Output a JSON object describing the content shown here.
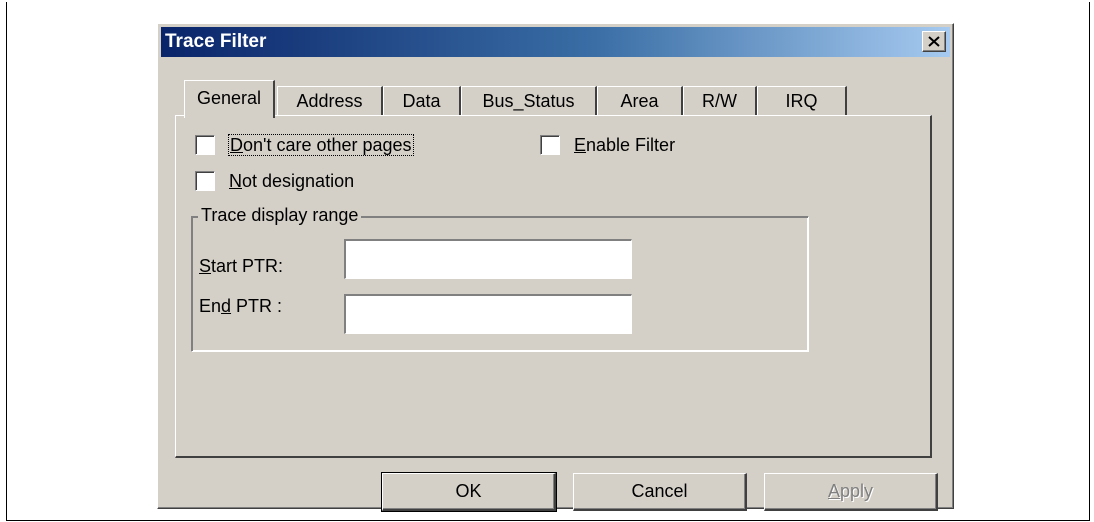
{
  "dialog": {
    "title": "Trace Filter",
    "close_label": "×"
  },
  "tabs": [
    {
      "label": "General",
      "active": true
    },
    {
      "label": "Address",
      "active": false
    },
    {
      "label": "Data",
      "active": false
    },
    {
      "label": "Bus_Status",
      "active": false
    },
    {
      "label": "Area",
      "active": false
    },
    {
      "label": "R/W",
      "active": false
    },
    {
      "label": "IRQ",
      "active": false
    }
  ],
  "general": {
    "dont_care": {
      "mnemonic": "D",
      "rest": "on't care other pages",
      "checked": false
    },
    "enable_filter": {
      "mnemonic": "E",
      "rest": "nable Filter",
      "checked": false
    },
    "not_designation": {
      "mnemonic": "N",
      "rest": "ot designation",
      "checked": false
    },
    "range_group": {
      "label": "Trace display range",
      "start_ptr": {
        "mnemonic": "S",
        "rest": "tart PTR:",
        "value": ""
      },
      "end_ptr": {
        "pre": "En",
        "mnemonic": "d",
        "rest": " PTR :",
        "value": ""
      }
    }
  },
  "buttons": {
    "ok": "OK",
    "cancel": "Cancel",
    "apply": {
      "mnemonic": "A",
      "rest": "pply",
      "enabled": false
    }
  },
  "colors": {
    "title_gradient_start": "#0a246a",
    "title_gradient_end": "#a6caf0",
    "face": "#d4d0c8"
  }
}
